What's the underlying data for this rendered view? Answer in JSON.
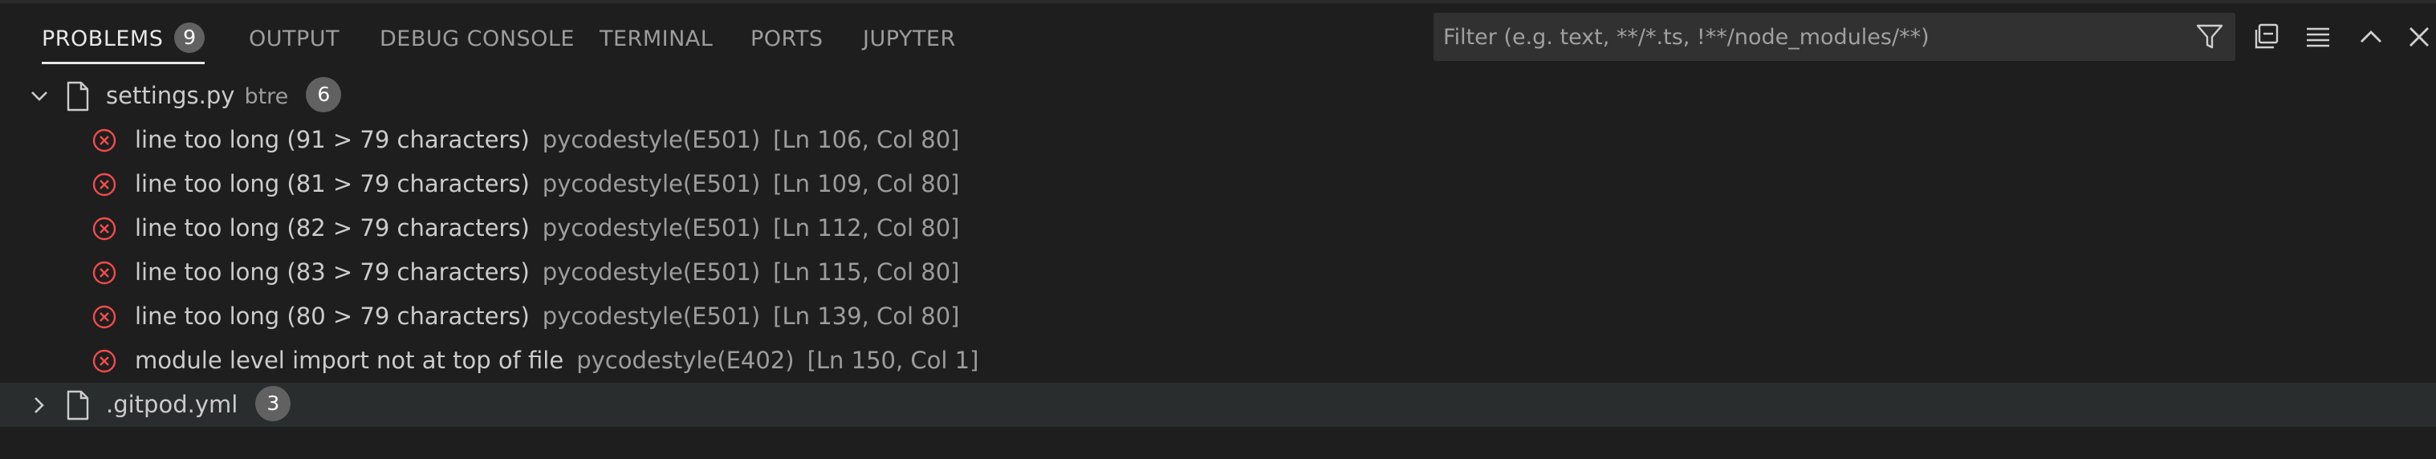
{
  "panel": {
    "tabs": [
      {
        "label": "PROBLEMS",
        "count": "9"
      },
      {
        "label": "OUTPUT"
      },
      {
        "label": "DEBUG CONSOLE"
      },
      {
        "label": "TERMINAL"
      },
      {
        "label": "PORTS"
      },
      {
        "label": "JUPYTER"
      }
    ],
    "filter": {
      "placeholder": "Filter (e.g. text, **/*.ts, !**/node_modules/**)",
      "value": ""
    },
    "toolbar_icons": [
      "filter-icon",
      "collapse-all-icon",
      "view-as-tree-icon",
      "maximize-panel-icon",
      "close-panel-icon"
    ]
  },
  "files": [
    {
      "name": "settings.py",
      "dir": "btre",
      "count": "6",
      "expanded": true,
      "problems": [
        {
          "message": "line too long (91 > 79 characters)",
          "source": "pycodestyle(E501)",
          "position": "[Ln 106, Col 80]"
        },
        {
          "message": "line too long (81 > 79 characters)",
          "source": "pycodestyle(E501)",
          "position": "[Ln 109, Col 80]"
        },
        {
          "message": "line too long (82 > 79 characters)",
          "source": "pycodestyle(E501)",
          "position": "[Ln 112, Col 80]"
        },
        {
          "message": "line too long (83 > 79 characters)",
          "source": "pycodestyle(E501)",
          "position": "[Ln 115, Col 80]"
        },
        {
          "message": "line too long (80 > 79 characters)",
          "source": "pycodestyle(E501)",
          "position": "[Ln 139, Col 80]"
        },
        {
          "message": "module level import not at top of file",
          "source": "pycodestyle(E402)",
          "position": "[Ln 150, Col 1]"
        }
      ]
    },
    {
      "name": ".gitpod.yml",
      "count": "3",
      "expanded": false
    }
  ],
  "colors": {
    "background": "#1e1e1e",
    "error": "#f14c4c",
    "badge": "#616161",
    "selected_row": "#2a2d2e"
  }
}
